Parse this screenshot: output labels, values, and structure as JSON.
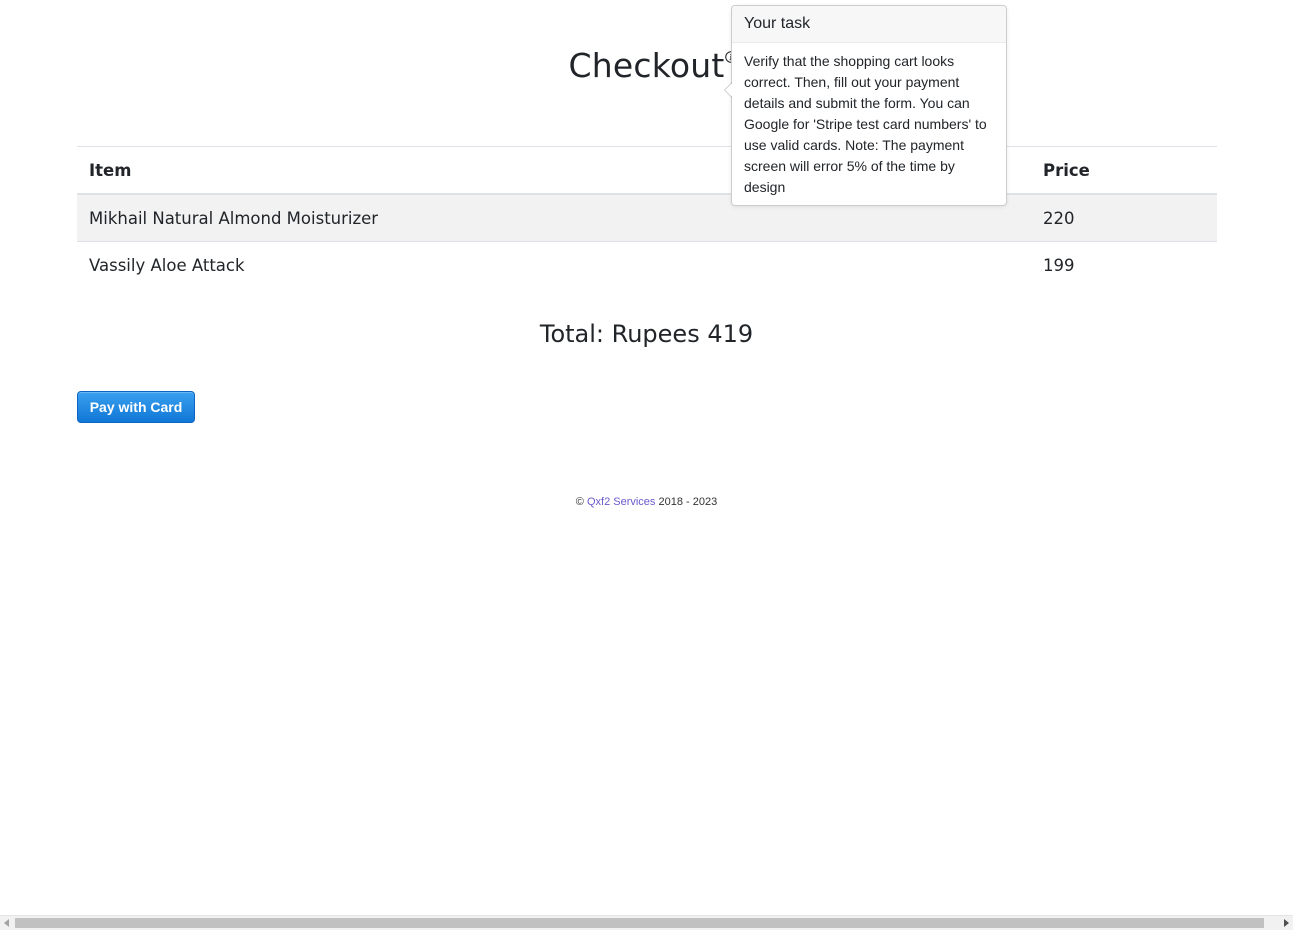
{
  "page": {
    "title": "Checkout"
  },
  "cart": {
    "columns": {
      "item": "Item",
      "price": "Price"
    },
    "rows": [
      {
        "item": "Mikhail Natural Almond Moisturizer",
        "price": "220"
      },
      {
        "item": "Vassily Aloe Attack",
        "price": "199"
      }
    ]
  },
  "total": {
    "text": "Total: Rupees 419"
  },
  "pay_button": {
    "label": "Pay with Card"
  },
  "footer": {
    "copyright": "©",
    "company": "Qxf2 Services",
    "years": "2018 - 2023"
  },
  "popover": {
    "title": "Your task",
    "body": "Verify that the shopping cart looks correct. Then, fill out your payment details and submit the form. You can Google for 'Stripe test card numbers' to use valid cards. Note: The payment screen will error 5% of the time by design"
  },
  "icons": {
    "info": "info-circle-icon"
  },
  "colors": {
    "button_top": "#3aa0f0",
    "button_bottom": "#1077d5",
    "link": "#6a5acd",
    "striped_row": "#f2f2f2"
  }
}
